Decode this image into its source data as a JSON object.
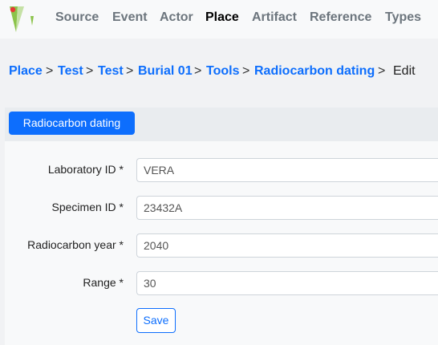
{
  "nav": {
    "items": [
      {
        "label": "Source",
        "active": false
      },
      {
        "label": "Event",
        "active": false
      },
      {
        "label": "Actor",
        "active": false
      },
      {
        "label": "Place",
        "active": true
      },
      {
        "label": "Artifact",
        "active": false
      },
      {
        "label": "Reference",
        "active": false
      },
      {
        "label": "Types",
        "active": false
      }
    ]
  },
  "breadcrumb": {
    "links": [
      "Place",
      "Test",
      "Test",
      "Burial 01",
      "Tools",
      "Radiocarbon dating"
    ],
    "separator": ">",
    "current": "Edit"
  },
  "panel": {
    "tab_label": "Radiocarbon dating"
  },
  "form": {
    "fields": [
      {
        "label": "Laboratory ID *",
        "value": "VERA"
      },
      {
        "label": "Specimen ID *",
        "value": "23432A"
      },
      {
        "label": "Radiocarbon year *",
        "value": "2040"
      },
      {
        "label": "Range *",
        "value": "30"
      }
    ],
    "save_label": "Save"
  },
  "colors": {
    "primary": "#0d6efd",
    "nav_text": "#6c757d",
    "nav_active": "#000000",
    "background": "#f1f2f4"
  },
  "icons": {
    "logo": "openatlas-logo-icon"
  }
}
